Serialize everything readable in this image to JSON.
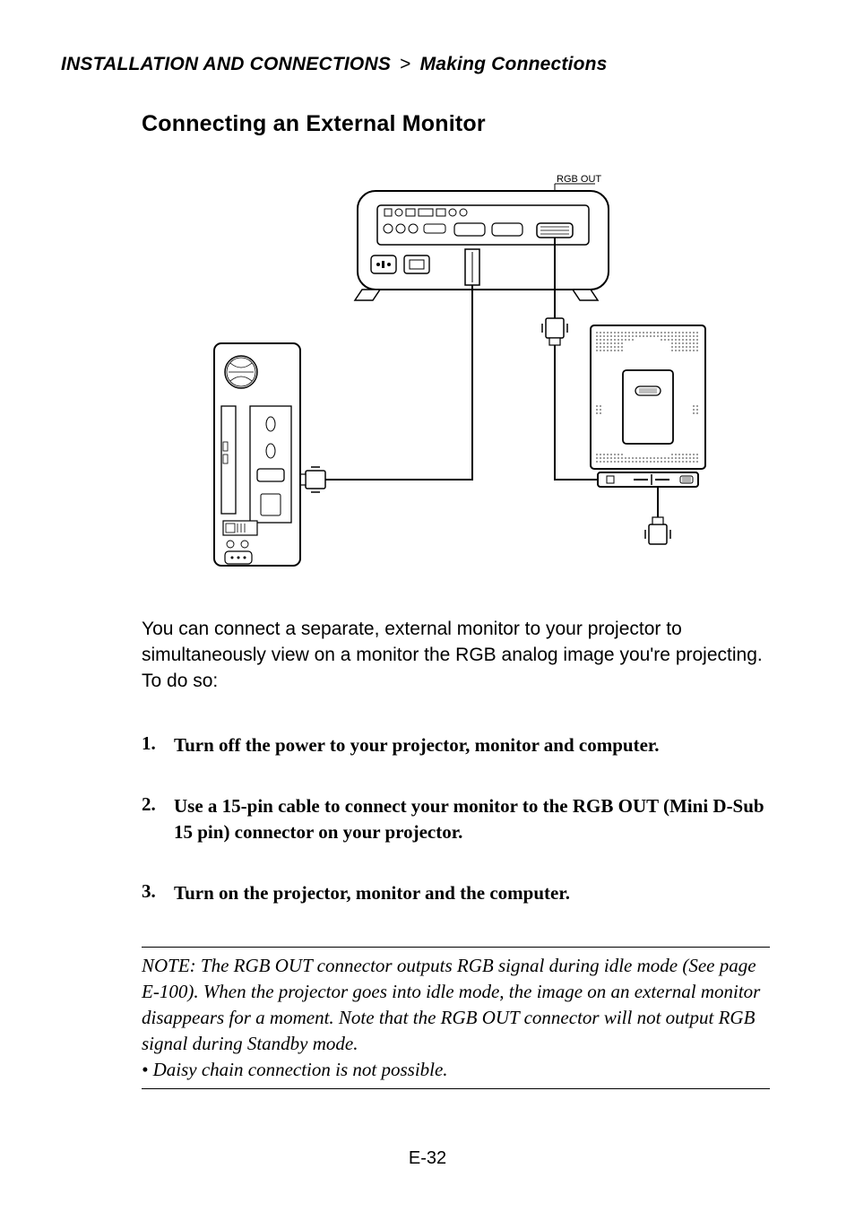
{
  "breadcrumb": {
    "section": "INSTALLATION AND CONNECTIONS",
    "separator": ">",
    "subsection": "Making Connections"
  },
  "title": "Connecting an External Monitor",
  "diagram": {
    "label_rgb_out": "RGB OUT"
  },
  "intro": "You can connect a separate, external monitor to your projector to simultaneously view on a monitor the RGB analog image you're projecting. To do so:",
  "steps": [
    {
      "num": "1.",
      "text": "Turn off the power to your projector, monitor and computer."
    },
    {
      "num": "2.",
      "text": "Use a 15-pin cable to connect your monitor to the RGB OUT (Mini D-Sub 15 pin) connector on your projector."
    },
    {
      "num": "3.",
      "text": "Turn on the projector, monitor and the computer."
    }
  ],
  "note": {
    "body": "NOTE: The RGB OUT connector outputs RGB signal during idle mode (See page E-100). When the projector goes into idle mode, the image on an external monitor disappears for a moment. Note that the RGB OUT connector will not output RGB signal during Standby mode.",
    "bullet": "• Daisy chain connection is not possible."
  },
  "page_number": "E-32"
}
